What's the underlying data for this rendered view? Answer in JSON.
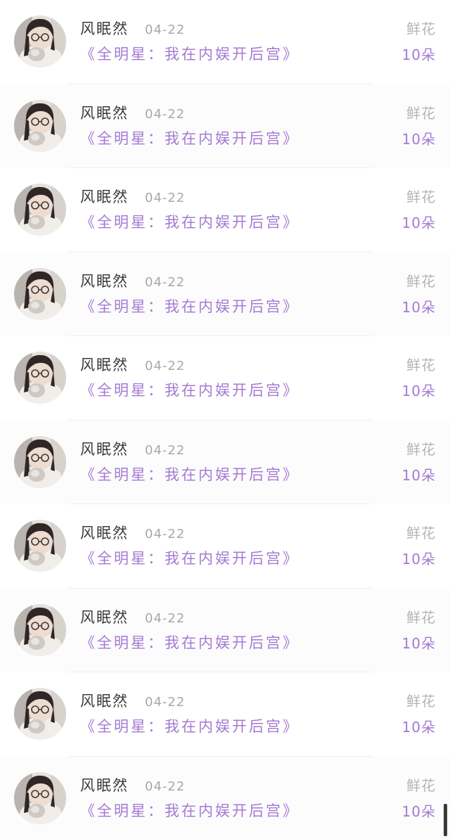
{
  "list": {
    "items": [
      {
        "name": "风眠然",
        "date": "04-22",
        "book_title": "《全明星：我在内娱开后宫》",
        "gift_type": "鲜花",
        "gift_count": "10朵"
      },
      {
        "name": "风眠然",
        "date": "04-22",
        "book_title": "《全明星：我在内娱开后宫》",
        "gift_type": "鲜花",
        "gift_count": "10朵"
      },
      {
        "name": "风眠然",
        "date": "04-22",
        "book_title": "《全明星：我在内娱开后宫》",
        "gift_type": "鲜花",
        "gift_count": "10朵"
      },
      {
        "name": "风眠然",
        "date": "04-22",
        "book_title": "《全明星：我在内娱开后宫》",
        "gift_type": "鲜花",
        "gift_count": "10朵"
      },
      {
        "name": "风眠然",
        "date": "04-22",
        "book_title": "《全明星：我在内娱开后宫》",
        "gift_type": "鲜花",
        "gift_count": "10朵"
      },
      {
        "name": "风眠然",
        "date": "04-22",
        "book_title": "《全明星：我在内娱开后宫》",
        "gift_type": "鲜花",
        "gift_count": "10朵"
      },
      {
        "name": "风眠然",
        "date": "04-22",
        "book_title": "《全明星：我在内娱开后宫》",
        "gift_type": "鲜花",
        "gift_count": "10朵"
      },
      {
        "name": "风眠然",
        "date": "04-22",
        "book_title": "《全明星：我在内娱开后宫》",
        "gift_type": "鲜花",
        "gift_count": "10朵"
      },
      {
        "name": "风眠然",
        "date": "04-22",
        "book_title": "《全明星：我在内娱开后宫》",
        "gift_type": "鲜花",
        "gift_count": "10朵"
      },
      {
        "name": "风眠然",
        "date": "04-22",
        "book_title": "《全明星：我在内娱开后宫》",
        "gift_type": "鲜花",
        "gift_count": "10朵"
      }
    ]
  },
  "colors": {
    "title_purple": "#a47ad2",
    "name_dark": "#3c3c3c",
    "meta_gray": "#a8a8a8"
  },
  "icons": {
    "avatar": "user-avatar-photo"
  }
}
